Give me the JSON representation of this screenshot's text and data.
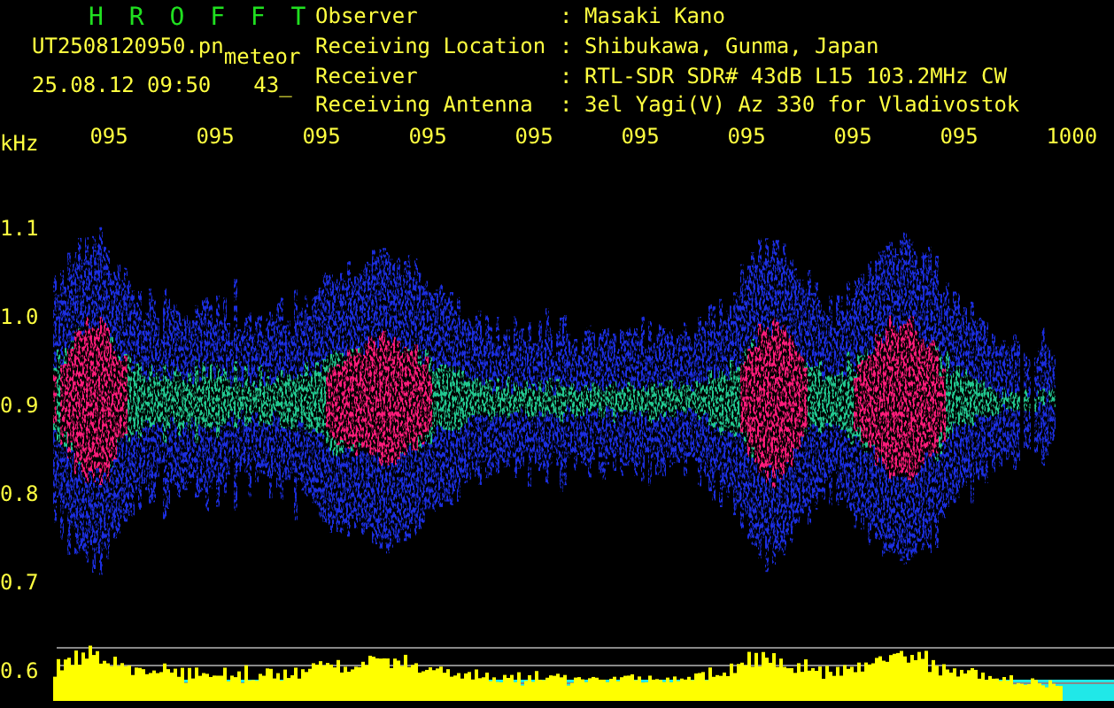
{
  "title": "H R O F F T",
  "file": {
    "name": "UT2508120950.pn",
    "type": "meteor",
    "datetime": "25.08.12 09:50",
    "count": "43_"
  },
  "info": [
    {
      "label": "Observer",
      "separator": ":",
      "value": "Masaki Kano"
    },
    {
      "label": "Receiving Location",
      "separator": ":",
      "value": "Shibukawa, Gunma, Japan"
    },
    {
      "label": "Receiver",
      "separator": ":",
      "value": "RTL-SDR SDR# 43dB L15 103.2MHz CW"
    },
    {
      "label": "Receiving Antenna",
      "separator": ":",
      "value": "3el Yagi(V) Az 330 for Vladivostok"
    }
  ],
  "y_axis": {
    "unit": "kHz",
    "labels": [
      "1.1",
      "1.0",
      "0.9",
      "0.8",
      "0.7",
      "0.6"
    ]
  },
  "time_labels": [
    "095",
    "095",
    "095",
    "095",
    "095",
    "095",
    "095",
    "095",
    "095",
    "1000"
  ]
}
